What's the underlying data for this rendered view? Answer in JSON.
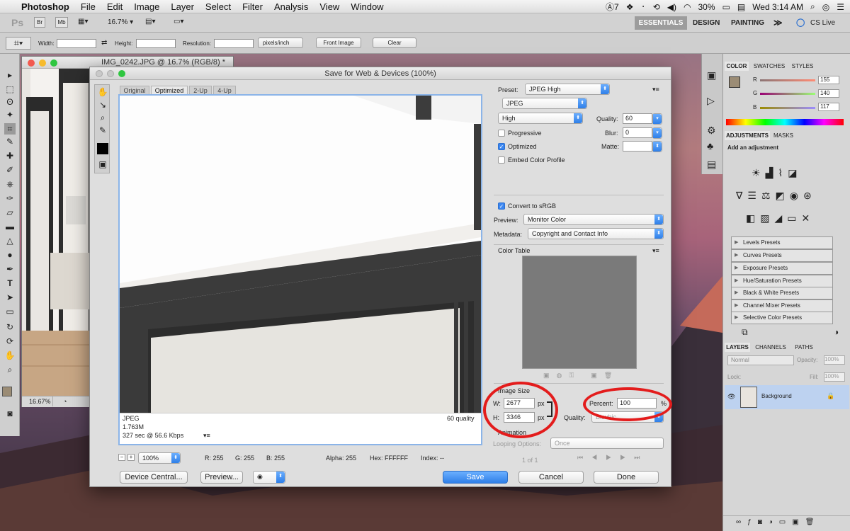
{
  "menubar": {
    "apple": "",
    "app": "Photoshop",
    "items": [
      "File",
      "Edit",
      "Image",
      "Layer",
      "Select",
      "Filter",
      "Analysis",
      "View",
      "Window"
    ],
    "status": {
      "adobe_count": "7",
      "battery": "30%",
      "clock": "Wed 3:14 AM"
    }
  },
  "appbar": {
    "logo": "Ps",
    "br": "Br",
    "mb": "Mb",
    "zoom": "16.7%",
    "workspaces": [
      "ESSENTIALS",
      "DESIGN",
      "PAINTING"
    ],
    "more": "≫",
    "cslive": "CS Live"
  },
  "options": {
    "width_label": "Width:",
    "height_label": "Height:",
    "resolution_label": "Resolution:",
    "units": "pixels/inch",
    "front_image": "Front Image",
    "clear": "Clear"
  },
  "document": {
    "title": "IMG_0242.JPG @ 16.7% (RGB/8) *",
    "zoom": "16.67%"
  },
  "dialog": {
    "title": "Save for Web & Devices (100%)",
    "view_tabs": [
      "Original",
      "Optimized",
      "2-Up",
      "4-Up"
    ],
    "preview_info": {
      "format": "JPEG",
      "size": "1.763M",
      "time": "327 sec @ 56.6 Kbps",
      "quality": "60 quality"
    },
    "preset": {
      "label": "Preset:",
      "value": "JPEG High"
    },
    "format": "JPEG",
    "compression": "High",
    "quality": {
      "label": "Quality:",
      "value": "60"
    },
    "blur": {
      "label": "Blur:",
      "value": "0"
    },
    "matte": {
      "label": "Matte:"
    },
    "progressive": "Progressive",
    "optimized": "Optimized",
    "embed": "Embed Color Profile",
    "convert": "Convert to sRGB",
    "preview": {
      "label": "Preview:",
      "value": "Monitor Color"
    },
    "metadata": {
      "label": "Metadata:",
      "value": "Copyright and Contact Info"
    },
    "color_table": "Color Table",
    "image_size": {
      "title": "Image Size",
      "w_label": "W:",
      "w": "2677",
      "h_label": "H:",
      "h": "3346",
      "unit": "px",
      "percent_label": "Percent:",
      "percent": "100",
      "percent_unit": "%",
      "quality_label": "Quality:",
      "quality_value": "Bicubic"
    },
    "animation": {
      "title": "Animation",
      "looping_label": "Looping Options:",
      "looping": "Once",
      "frame": "1 of 1"
    },
    "bottom": {
      "zoom": "100%",
      "r": "R: 255",
      "g": "G: 255",
      "b": "B: 255",
      "alpha": "Alpha: 255",
      "hex": "Hex: FFFFFF",
      "index": "Index: --"
    },
    "buttons": {
      "device_central": "Device Central...",
      "preview": "Preview...",
      "save": "Save",
      "cancel": "Cancel",
      "done": "Done"
    }
  },
  "color_panel": {
    "tabs": [
      "COLOR",
      "SWATCHES",
      "STYLES"
    ],
    "r_label": "R",
    "r": "155",
    "g_label": "G",
    "g": "140",
    "b_label": "B",
    "b": "117",
    "fg": "#9b8c75"
  },
  "adjust_panel": {
    "tabs": [
      "ADJUSTMENTS",
      "MASKS"
    ],
    "heading": "Add an adjustment",
    "presets": [
      "Levels Presets",
      "Curves Presets",
      "Exposure Presets",
      "Hue/Saturation Presets",
      "Black & White Presets",
      "Channel Mixer Presets",
      "Selective Color Presets"
    ]
  },
  "layers_panel": {
    "tabs": [
      "LAYERS",
      "CHANNELS",
      "PATHS"
    ],
    "blend": "Normal",
    "opacity_label": "Opacity:",
    "opacity": "100%",
    "lock_label": "Lock:",
    "fill_label": "Fill:",
    "fill": "100%",
    "layer": "Background"
  },
  "colors": {
    "accent": "#3b86f0",
    "ring": "#e31c1c"
  }
}
